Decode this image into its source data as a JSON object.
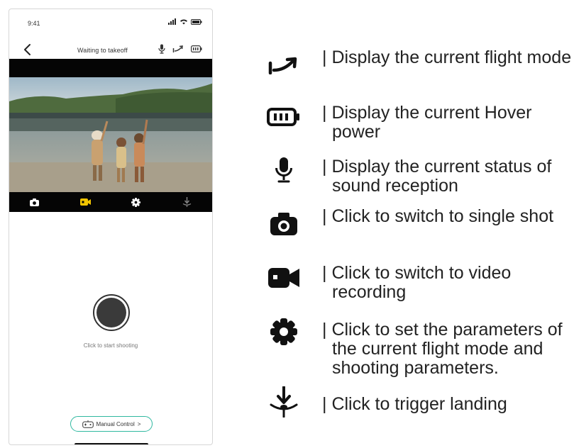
{
  "status_bar": {
    "time": "9:41"
  },
  "nav": {
    "title": "Waiting to takeoff"
  },
  "main": {
    "shutter_hint": "Click to start shooting",
    "manual_control_label": "Manual Control",
    "manual_control_chevron": ">"
  },
  "mode_bar": {
    "active_mode": "video",
    "active_color": "#f2c500",
    "inactive_color": "#ffffff"
  },
  "legend": {
    "items": [
      {
        "icon": "flight-mode-icon",
        "text": "| Display the current flight mode"
      },
      {
        "icon": "battery-icon",
        "text": "| Display the current Hover power"
      },
      {
        "icon": "microphone-icon",
        "text": "| Display the current status of sound reception"
      },
      {
        "icon": "camera-icon",
        "text": "| Click to switch to single shot"
      },
      {
        "icon": "video-camera-icon",
        "text": "| Click to switch to video recording"
      },
      {
        "icon": "gear-icon",
        "text": "| Click to set the parameters of the current flight mode and shooting parameters."
      },
      {
        "icon": "landing-icon",
        "text": "| Click to trigger landing"
      }
    ]
  }
}
